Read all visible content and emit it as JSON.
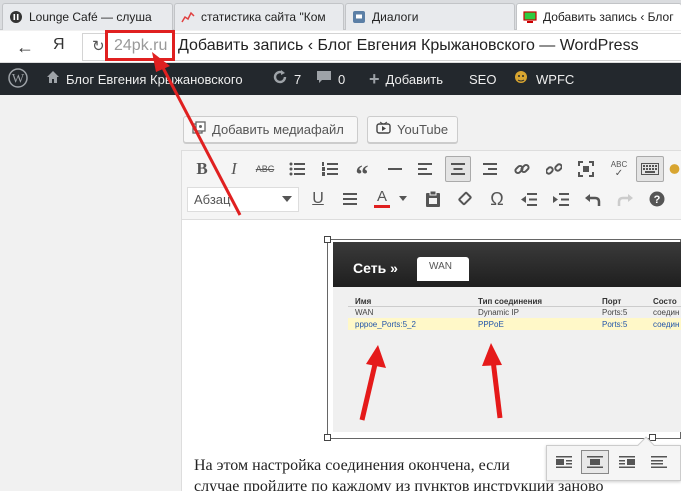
{
  "browser": {
    "tabs": [
      {
        "title": "Lounge Café — слуша",
        "icon": "pause-icon"
      },
      {
        "title": "статистика сайта \"Ком",
        "icon": "stats-chart-icon"
      },
      {
        "title": "Диалоги",
        "icon": "vk-dialogs-icon"
      },
      {
        "title": "Добавить запись ‹ Блог",
        "icon": "monitor-icon",
        "active": true
      }
    ],
    "nav_back": "←",
    "yandex_logo": "Я",
    "reload": "↻",
    "domain": "24pk.ru",
    "page_title": "Добавить запись ‹ Блог Евгения Крыжановского — WordPress"
  },
  "adminbar": {
    "wp_logo": "W",
    "site_name": "Блог Евгения Крыжановского",
    "updates_count": "7",
    "comments_count": "0",
    "add_new": "Добавить",
    "seo": "SEO",
    "wpfc": "WPFC"
  },
  "editor": {
    "add_media": "Добавить медиафайл",
    "youtube": "YouTube",
    "format_select": "Абзац",
    "toolbar_row1": [
      "bold-icon",
      "italic-icon",
      "strikethrough-icon",
      "blockquote-icon",
      "hr-icon",
      "align-left-icon",
      "align-center-icon",
      "align-right-icon",
      "link-icon",
      "unlink-icon",
      "fullscreen-icon",
      "spellcheck-icon",
      "keyboard-icon"
    ],
    "toolbar_row2": [
      "underline-icon",
      "justify-icon",
      "text-color-icon",
      "paste-text-icon",
      "clear-format-icon",
      "omega-icon",
      "outdent-icon",
      "indent-icon",
      "undo-icon",
      "redo-icon",
      "help-icon"
    ],
    "text_color_label": "A",
    "body_line1": "На этом настройка соединения окончена, если",
    "body_line2": "случае пройдите по каждому из пунктов инструкции заново"
  },
  "embedded_image": {
    "section_title": "Сеть »",
    "active_tab": "WAN",
    "headers": [
      "Имя",
      "Тип соединения",
      "Порт",
      "Состо"
    ],
    "rows": [
      [
        "WAN",
        "Dynamic IP",
        "Ports:5",
        "соедин"
      ],
      [
        "pppoe_Ports:5_2",
        "PPPoE",
        "Ports:5",
        "соедин"
      ]
    ]
  },
  "colors": {
    "accent_red": "#e02020",
    "adminbar_bg": "#23282d"
  }
}
